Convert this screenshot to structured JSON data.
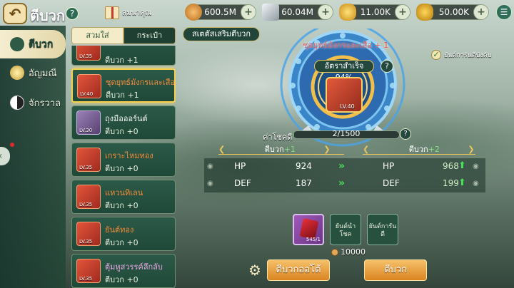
{
  "header": {
    "title": "ตีบวก",
    "help_label": "?",
    "gift_label": "สมนาคุณ",
    "back_glyph": "↶"
  },
  "resources": [
    {
      "name": "silver-coin",
      "value": "600.5M",
      "color": "#e7a03c"
    },
    {
      "name": "silver-bar",
      "value": "60.04M",
      "color": "#cfd8dc"
    },
    {
      "name": "gold-ingot",
      "value": "11.00K",
      "color": "#f2c02c"
    },
    {
      "name": "gold-ingot-bound",
      "value": "50.00K",
      "color": "#e8b323"
    }
  ],
  "nav": {
    "items": [
      {
        "label": "ตีบวก",
        "icon": "anvil-icon",
        "active": true
      },
      {
        "label": "อัญมณี",
        "icon": "gem-icon",
        "active": false
      },
      {
        "label": "จักรวาล",
        "icon": "yin-yang-icon",
        "active": false
      }
    ]
  },
  "tabs": {
    "equipped": "สวมใส่",
    "bag": "กระเป๋า"
  },
  "items": [
    {
      "name": "",
      "level": "LV.35",
      "plus": "ตีบวก +1",
      "plus_value": "+1",
      "name_color": "orange",
      "thumb": "red"
    },
    {
      "name": "ชุดยุทธ์มังกรและเสือ",
      "level": "LV.40",
      "plus": "ตีบวก +1",
      "plus_value": "+1",
      "name_color": "orange",
      "thumb": "red",
      "selected": true
    },
    {
      "name": "ถุงมือออร์นต์",
      "level": "LV.30",
      "plus": "ตีบวก +0",
      "plus_value": "+0",
      "name_color": "white",
      "thumb": "purple"
    },
    {
      "name": "เกราะไหมทอง",
      "level": "LV.35",
      "plus": "ตีบวก +0",
      "plus_value": "+0",
      "name_color": "orange",
      "thumb": "red"
    },
    {
      "name": "แหวนทิเลน",
      "level": "LV.35",
      "plus": "ตีบวก +0",
      "plus_value": "+0",
      "name_color": "orange",
      "thumb": "red"
    },
    {
      "name": "ยันต์ทอง",
      "level": "LV.35",
      "plus": "ตีบวก +0",
      "plus_value": "+0",
      "name_color": "orange",
      "thumb": "red"
    },
    {
      "name": "ตุ้มหูสวรรค์ลึกลับ",
      "level": "LV.35",
      "plus": "ตีบวก +0",
      "plus_value": "+0",
      "name_color": "pink",
      "thumb": "red"
    }
  ],
  "panel": {
    "stat_pill": "สเตตัสเสริมตีบวก",
    "equip_title": "ชุดยุทธ์มังกรและเสือ + 1",
    "success_rate": "อัตราสำเร็จ 94%",
    "center_level": "LV.40",
    "auto_label": "ยันต์การันตีบังคับ",
    "luck_label": "ค่าโชคดี",
    "luck_text": "2/1500",
    "luck_progress": 0.0013,
    "current_level_label": "ตีบวก",
    "current_level_value": "+1",
    "next_level_label": "ตีบวก",
    "next_level_value": "+2"
  },
  "stats": [
    {
      "name": "HP",
      "current": "924",
      "next": "968"
    },
    {
      "name": "DEF",
      "current": "187",
      "next": "199"
    }
  ],
  "slots": {
    "gem_count": "545/1",
    "luck_slot": "ยันต์นำโชค",
    "guarantee_slot": "ยันต์การันตี",
    "cost": "10000"
  },
  "buttons": {
    "auto": "ตีบวกออโต้",
    "enhance": "ตีบวก"
  },
  "colors": {
    "accent": "#e8c65a",
    "green": "#4be05a",
    "button": "#d98420"
  }
}
